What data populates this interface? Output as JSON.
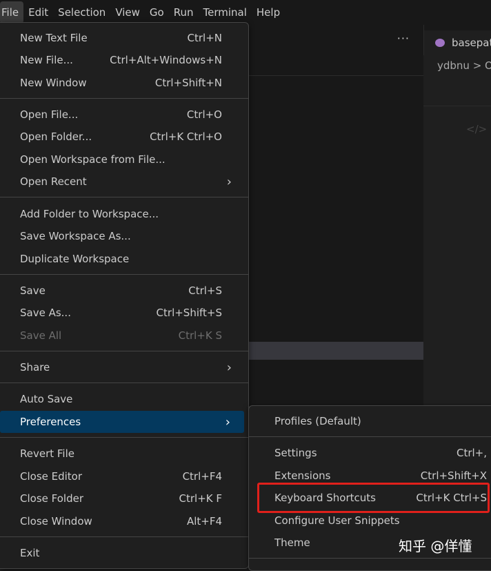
{
  "menubar": {
    "items": [
      "File",
      "Edit",
      "Selection",
      "View",
      "Go",
      "Run",
      "Terminal",
      "Help"
    ]
  },
  "editor": {
    "tab_label": "basepat",
    "breadcrumb": "ydbnu > O",
    "code_glyph": "</>",
    "more_glyph": "···"
  },
  "file_menu": {
    "new_text_file": {
      "label": "New Text File",
      "kb": "Ctrl+N"
    },
    "new_file": {
      "label": "New File...",
      "kb": "Ctrl+Alt+Windows+N"
    },
    "new_window": {
      "label": "New Window",
      "kb": "Ctrl+Shift+N"
    },
    "open_file": {
      "label": "Open File...",
      "kb": "Ctrl+O"
    },
    "open_folder": {
      "label": "Open Folder...",
      "kb": "Ctrl+K Ctrl+O"
    },
    "open_workspace": {
      "label": "Open Workspace from File..."
    },
    "open_recent": {
      "label": "Open Recent"
    },
    "add_folder": {
      "label": "Add Folder to Workspace..."
    },
    "save_workspace_as": {
      "label": "Save Workspace As..."
    },
    "duplicate_workspace": {
      "label": "Duplicate Workspace"
    },
    "save": {
      "label": "Save",
      "kb": "Ctrl+S"
    },
    "save_as": {
      "label": "Save As...",
      "kb": "Ctrl+Shift+S"
    },
    "save_all": {
      "label": "Save All",
      "kb": "Ctrl+K S"
    },
    "share": {
      "label": "Share"
    },
    "auto_save": {
      "label": "Auto Save"
    },
    "preferences": {
      "label": "Preferences"
    },
    "revert_file": {
      "label": "Revert File"
    },
    "close_editor": {
      "label": "Close Editor",
      "kb": "Ctrl+F4"
    },
    "close_folder": {
      "label": "Close Folder",
      "kb": "Ctrl+K F"
    },
    "close_window": {
      "label": "Close Window",
      "kb": "Alt+F4"
    },
    "exit": {
      "label": "Exit"
    }
  },
  "preferences_menu": {
    "profiles": {
      "label": "Profiles (Default)"
    },
    "settings": {
      "label": "Settings",
      "kb": "Ctrl+,"
    },
    "extensions": {
      "label": "Extensions",
      "kb": "Ctrl+Shift+X"
    },
    "keyboard_shortcuts": {
      "label": "Keyboard Shortcuts",
      "kb": "Ctrl+K Ctrl+S"
    },
    "configure_snippets": {
      "label": "Configure User Snippets"
    },
    "theme": {
      "label": "Theme"
    }
  },
  "watermark": "知乎 @佯懂",
  "colors": {
    "highlight": "#04395e",
    "annotation_red": "#e0201b",
    "menu_bg": "#1f1f1f"
  }
}
